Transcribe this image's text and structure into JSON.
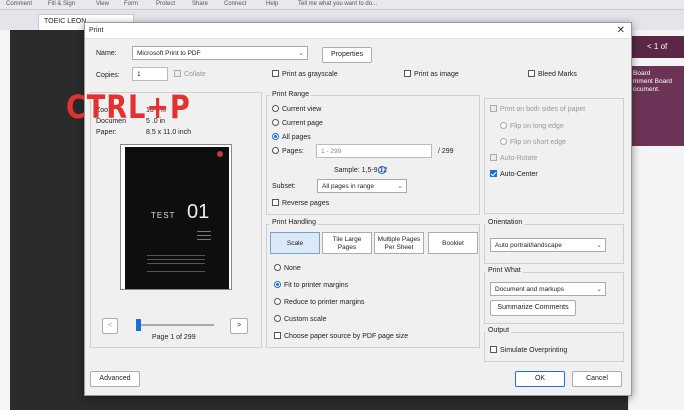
{
  "app": {
    "menu": [
      "Comment",
      "Fill & Sign",
      "View",
      "Form",
      "Protect",
      "Share",
      "Connect",
      "Help",
      "Tell me what you want to do..."
    ],
    "tab_title": "TOEIC LEON ...",
    "right_panel": {
      "header": "< 1 of",
      "lines": [
        "Board",
        "mment Board",
        "ocument."
      ]
    }
  },
  "dialog": {
    "title": "Print",
    "close_glyph": "✕",
    "name_label": "Name:",
    "printer": "Microsoft Print to PDF",
    "properties_btn": "Properties",
    "copies_label": "Copies:",
    "copies_value": "1",
    "collate": "Collate",
    "grayscale": "Print as grayscale",
    "as_image": "Print as image",
    "bleed_marks": "Bleed Marks",
    "preview_info": {
      "zoom_label": "Zoo",
      "zoom_value": "10  4%",
      "document_label": "Documen",
      "document_value": "5  .0 in",
      "paper_label": "Paper:",
      "paper_value": "8.5 x 11.0 inch"
    },
    "page_preview": {
      "title": "TEST",
      "number": "01"
    },
    "page_counter": "Page 1 of 299",
    "prev_glyph": "<",
    "next_glyph": ">",
    "overlay_text": "CTRL+P",
    "print_range": {
      "title": "Print Range",
      "current_view": "Current view",
      "current_page": "Current page",
      "all_pages": "All pages",
      "pages_label": "Pages:",
      "pages_placeholder": "1 - 299",
      "pages_total": "/ 299",
      "sample": "Sample: 1,5-9,12",
      "subset_label": "Subset:",
      "subset_value": "All pages in range",
      "reverse": "Reverse pages"
    },
    "print_handling": {
      "title": "Print Handling",
      "tabs": [
        "Scale",
        "Tile Large Pages",
        "Multiple Pages Per Sheet",
        "Booklet"
      ],
      "none": "None",
      "fit_margins": "Fit to printer margins",
      "reduce_margins": "Reduce to printer margins",
      "custom_scale": "Custom scale",
      "paper_source": "Choose paper source by PDF page size"
    },
    "duplex": {
      "both_sides": "Print on both sides of paper",
      "flip_long": "Flip on long edge",
      "flip_short": "Flip on short edge",
      "auto_rotate": "Auto-Rotate",
      "auto_center": "Auto-Center"
    },
    "orientation": {
      "title": "Orientation",
      "value": "Auto portrait/landscape"
    },
    "print_what": {
      "title": "Print What",
      "value": "Document and markups",
      "summarize": "Summarize Comments"
    },
    "output": {
      "title": "Output",
      "simulate": "Simulate Overprinting"
    },
    "advanced_btn": "Advanced",
    "ok_btn": "OK",
    "cancel_btn": "Cancel"
  }
}
